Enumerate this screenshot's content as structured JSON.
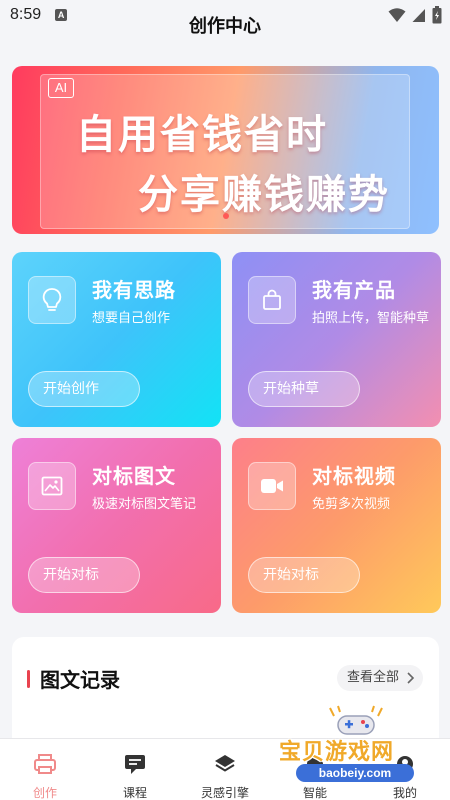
{
  "status_bar": {
    "time": "8:59",
    "notification_icon": "a-icon",
    "icons": [
      "wifi-icon",
      "signal-icon",
      "battery-icon"
    ]
  },
  "header": {
    "title": "创作中心"
  },
  "banner": {
    "badge": "AI",
    "line1": "自用省钱省时",
    "line2": "分享赚钱赚势"
  },
  "cards": [
    {
      "icon": "lightbulb-icon",
      "title": "我有思路",
      "desc": "想要自己创作",
      "button": "开始创作"
    },
    {
      "icon": "shopping-bag-icon",
      "title": "我有产品",
      "desc": "拍照上传，智能种草",
      "button": "开始种草"
    },
    {
      "icon": "image-icon",
      "title": "对标图文",
      "desc": "极速对标图文笔记",
      "button": "开始对标"
    },
    {
      "icon": "video-camera-icon",
      "title": "对标视频",
      "desc": "免剪多次视频",
      "button": "开始对标"
    }
  ],
  "records": {
    "title": "图文记录",
    "view_all": "查看全部"
  },
  "tabbar": {
    "items": [
      {
        "label": "创作",
        "icon": "printer-icon",
        "active": true
      },
      {
        "label": "课程",
        "icon": "chat-screen-icon",
        "active": false
      },
      {
        "label": "灵感引擎",
        "icon": "layers-icon",
        "active": false
      },
      {
        "label": "智能",
        "icon": "smart-icon",
        "active": false
      },
      {
        "label": "我的",
        "icon": "profile-icon",
        "active": false
      }
    ]
  },
  "watermark": {
    "text": "宝贝游戏网",
    "url": "baobeiy.com"
  },
  "colors": {
    "accent": "#e9434f",
    "tab_active": "#f08a8a"
  }
}
